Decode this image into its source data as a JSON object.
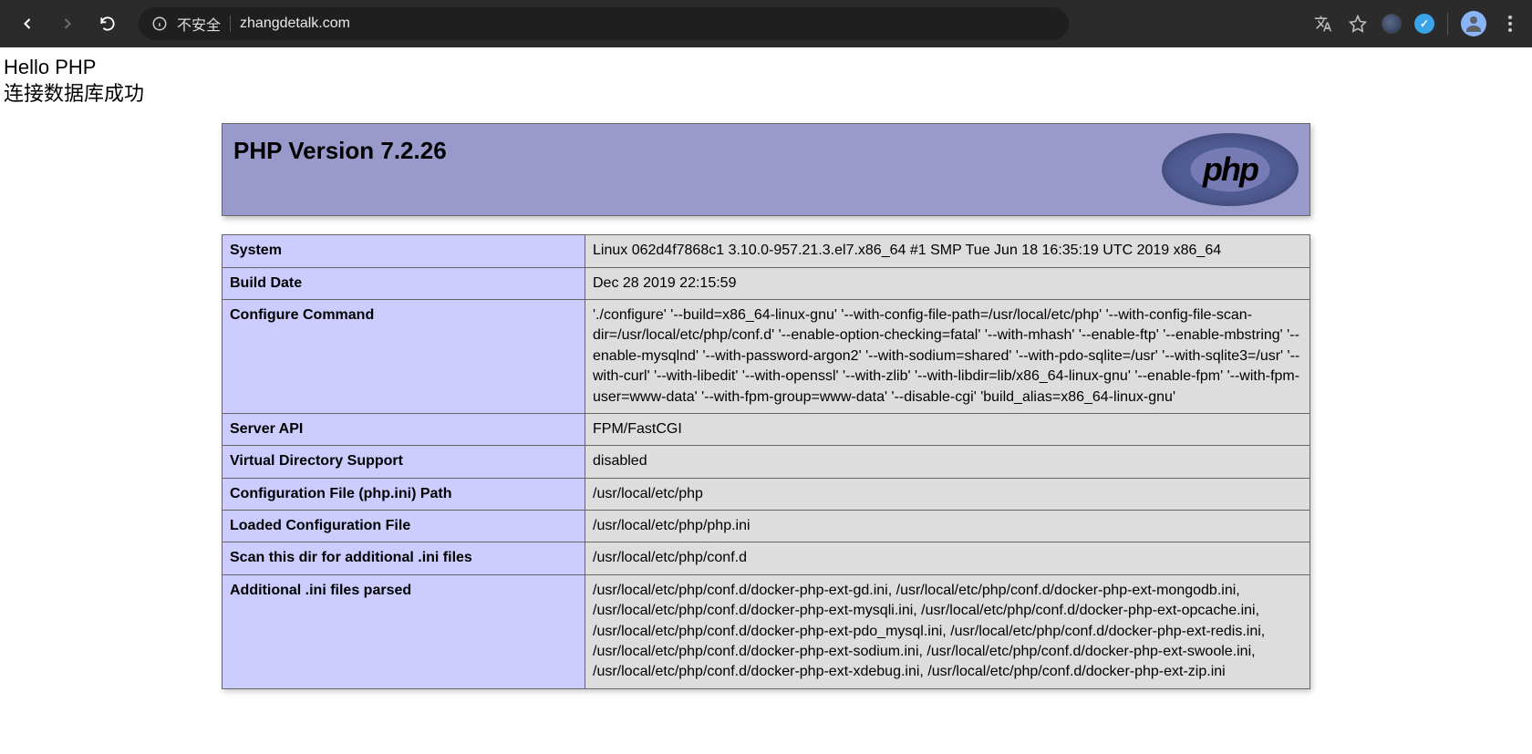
{
  "browser": {
    "security_label": "不安全",
    "url": "zhangdetalk.com"
  },
  "page": {
    "hello_line1": "Hello PHP",
    "hello_line2": "连接数据库成功"
  },
  "phpinfo": {
    "title": "PHP Version 7.2.26",
    "logo_text": "php",
    "rows": [
      {
        "label": "System",
        "value": "Linux 062d4f7868c1 3.10.0-957.21.3.el7.x86_64 #1 SMP Tue Jun 18 16:35:19 UTC 2019 x86_64"
      },
      {
        "label": "Build Date",
        "value": "Dec 28 2019 22:15:59"
      },
      {
        "label": "Configure Command",
        "value": "'./configure' '--build=x86_64-linux-gnu' '--with-config-file-path=/usr/local/etc/php' '--with-config-file-scan-dir=/usr/local/etc/php/conf.d' '--enable-option-checking=fatal' '--with-mhash' '--enable-ftp' '--enable-mbstring' '--enable-mysqlnd' '--with-password-argon2' '--with-sodium=shared' '--with-pdo-sqlite=/usr' '--with-sqlite3=/usr' '--with-curl' '--with-libedit' '--with-openssl' '--with-zlib' '--with-libdir=lib/x86_64-linux-gnu' '--enable-fpm' '--with-fpm-user=www-data' '--with-fpm-group=www-data' '--disable-cgi' 'build_alias=x86_64-linux-gnu'"
      },
      {
        "label": "Server API",
        "value": "FPM/FastCGI"
      },
      {
        "label": "Virtual Directory Support",
        "value": "disabled"
      },
      {
        "label": "Configuration File (php.ini) Path",
        "value": "/usr/local/etc/php"
      },
      {
        "label": "Loaded Configuration File",
        "value": "/usr/local/etc/php/php.ini"
      },
      {
        "label": "Scan this dir for additional .ini files",
        "value": "/usr/local/etc/php/conf.d"
      },
      {
        "label": "Additional .ini files parsed",
        "value": "/usr/local/etc/php/conf.d/docker-php-ext-gd.ini, /usr/local/etc/php/conf.d/docker-php-ext-mongodb.ini, /usr/local/etc/php/conf.d/docker-php-ext-mysqli.ini, /usr/local/etc/php/conf.d/docker-php-ext-opcache.ini, /usr/local/etc/php/conf.d/docker-php-ext-pdo_mysql.ini, /usr/local/etc/php/conf.d/docker-php-ext-redis.ini, /usr/local/etc/php/conf.d/docker-php-ext-sodium.ini, /usr/local/etc/php/conf.d/docker-php-ext-swoole.ini, /usr/local/etc/php/conf.d/docker-php-ext-xdebug.ini, /usr/local/etc/php/conf.d/docker-php-ext-zip.ini"
      }
    ]
  }
}
